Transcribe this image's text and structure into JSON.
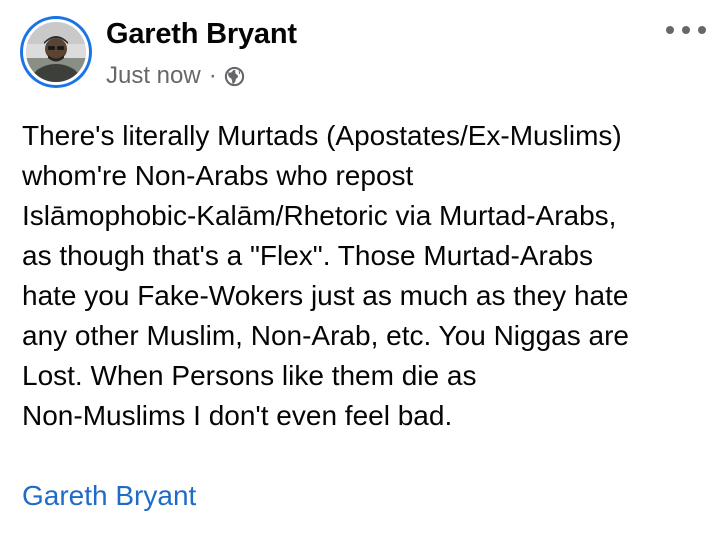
{
  "post": {
    "author": {
      "name": "Gareth Bryant",
      "avatar_icon": "profile-photo",
      "ring_color": "#1b74e4"
    },
    "meta": {
      "timestamp": "Just now",
      "separator": "·",
      "privacy_icon": "globe-icon"
    },
    "more_icon": "more-options-icon",
    "body_text": "There's literally Murtads (Apostates/Ex-Muslims)\nwhom're Non-Arabs who repost\nIslāmophobic-Kalām/Rhetoric via Murtad-Arabs,\nas though that's a \"Flex\". Those Murtad-Arabs\nhate you Fake-Wokers just as much as they hate\nany other Muslim, Non-Arab, etc. You Niggas are\nLost. When Persons like them die as\nNon-Muslims I don't even feel bad.",
    "signature_link": "Gareth Bryant",
    "link_color": "#1e6cc8"
  }
}
